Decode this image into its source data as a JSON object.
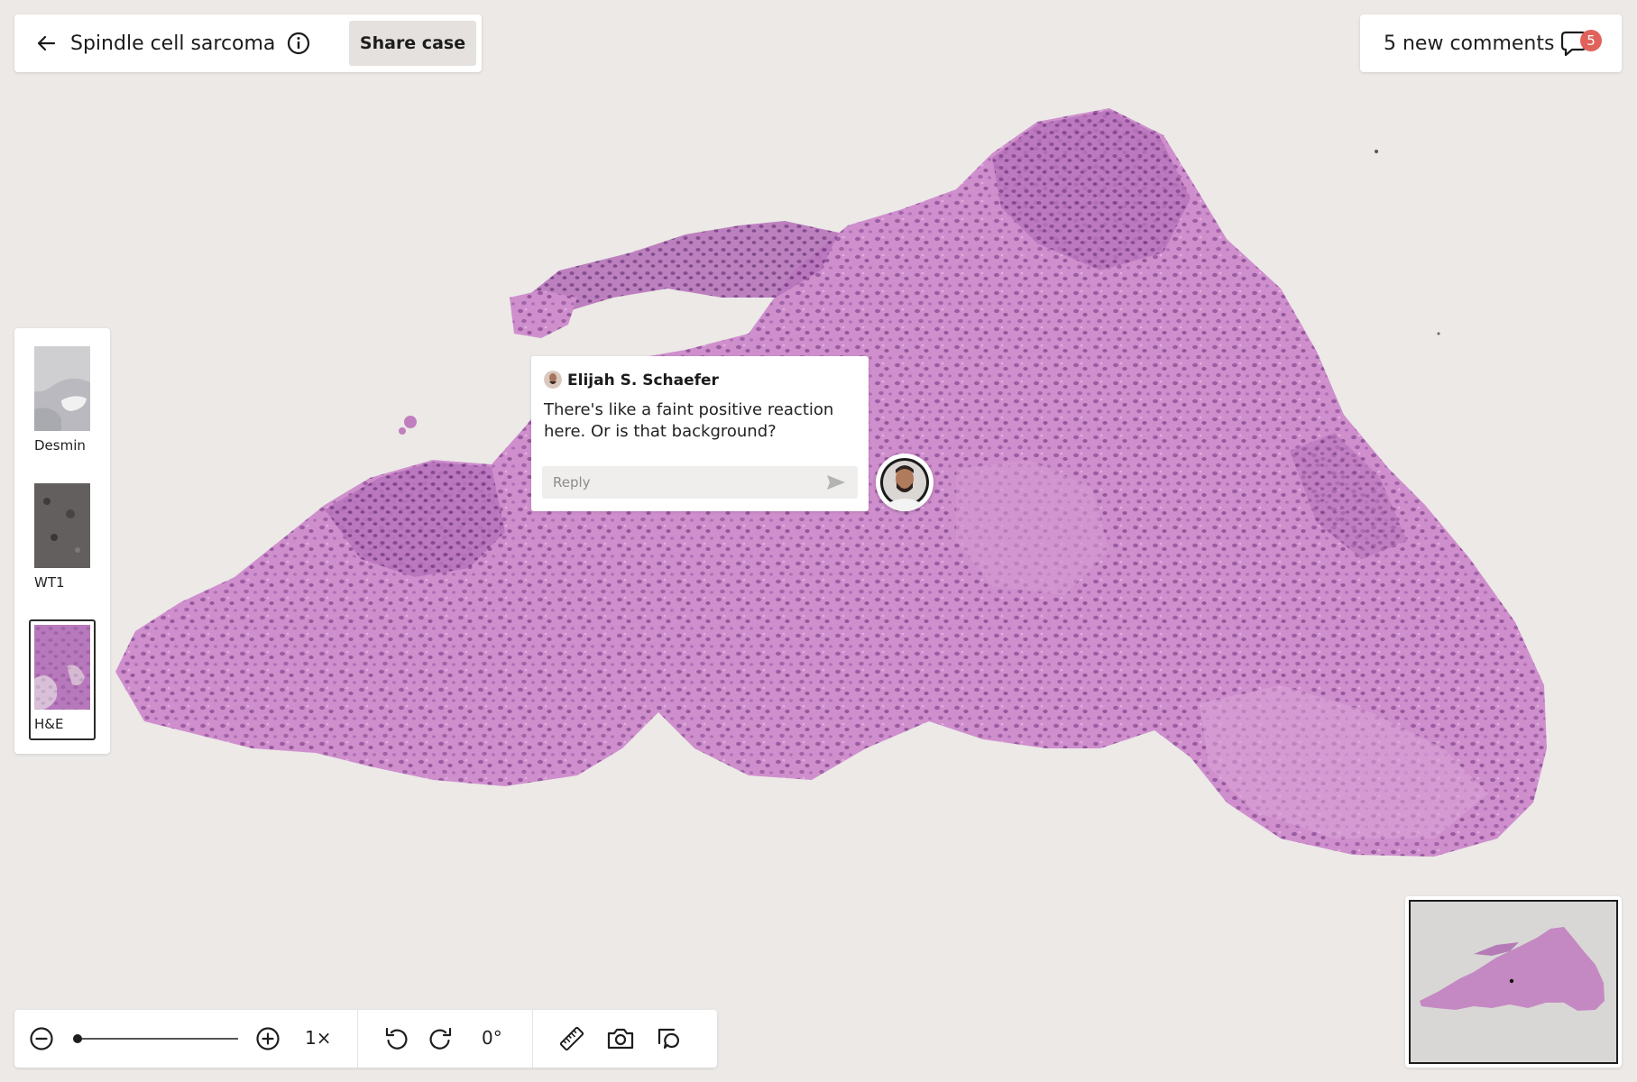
{
  "header": {
    "back_icon": "arrow-left-icon",
    "title": "Spindle cell sarcoma",
    "info_icon": "info-icon",
    "share_label": "Share case"
  },
  "comments_button": {
    "label": "5 new comments",
    "icon": "speech-bubble-icon",
    "badge_count": "5",
    "badge_color": "#e0625b"
  },
  "stains": [
    {
      "label": "Desmin",
      "selected": false
    },
    {
      "label": "WT1",
      "selected": false
    },
    {
      "label": "H&E",
      "selected": true
    }
  ],
  "comment": {
    "author": "Elijah S. Schaefer",
    "text": "There's like a faint positive reaction here. Or is that background?",
    "reply_placeholder": "Reply",
    "send_icon": "send-icon"
  },
  "toolbar": {
    "zoom_out_icon": "zoom-out-icon",
    "zoom_in_icon": "zoom-in-icon",
    "zoom_level": "1×",
    "zoom_slider_fraction": 0,
    "rotate_left_icon": "rotate-left-icon",
    "rotate_right_icon": "rotate-right-icon",
    "rotation": "0°",
    "ruler_icon": "ruler-icon",
    "camera_icon": "camera-icon",
    "comment_tool_icon": "comment-add-icon"
  },
  "colors": {
    "background": "#ece9e7",
    "tissue": "#c788c4",
    "nuclei": "#7a3f86",
    "accent_badge": "#e0625b"
  }
}
